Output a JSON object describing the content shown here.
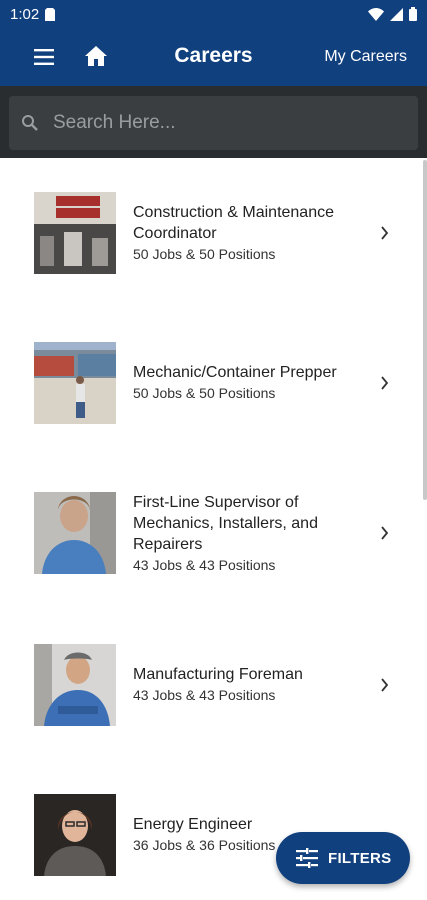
{
  "status_bar": {
    "time": "1:02"
  },
  "app_bar": {
    "title": "Careers",
    "my_careers_label": "My Careers",
    "menu_icon": "hamburger-menu-icon",
    "home_icon": "home-icon",
    "color": "#11407f"
  },
  "search": {
    "placeholder": "Search Here...",
    "value": ""
  },
  "careers": [
    {
      "title": "Construction & Maintenance Coordinator",
      "subtitle": "50 Jobs & 50 Positions"
    },
    {
      "title": "Mechanic/Container Prepper",
      "subtitle": "50 Jobs & 50 Positions"
    },
    {
      "title": "First-Line Supervisor of Mechanics, Installers, and Repairers",
      "subtitle": "43 Jobs & 43 Positions"
    },
    {
      "title": "Manufacturing Foreman",
      "subtitle": "43 Jobs & 43 Positions"
    },
    {
      "title": "Energy Engineer",
      "subtitle": "36 Jobs & 36 Positions"
    }
  ],
  "fab": {
    "label": "FILTERS",
    "icon": "filter-sliders-icon"
  }
}
